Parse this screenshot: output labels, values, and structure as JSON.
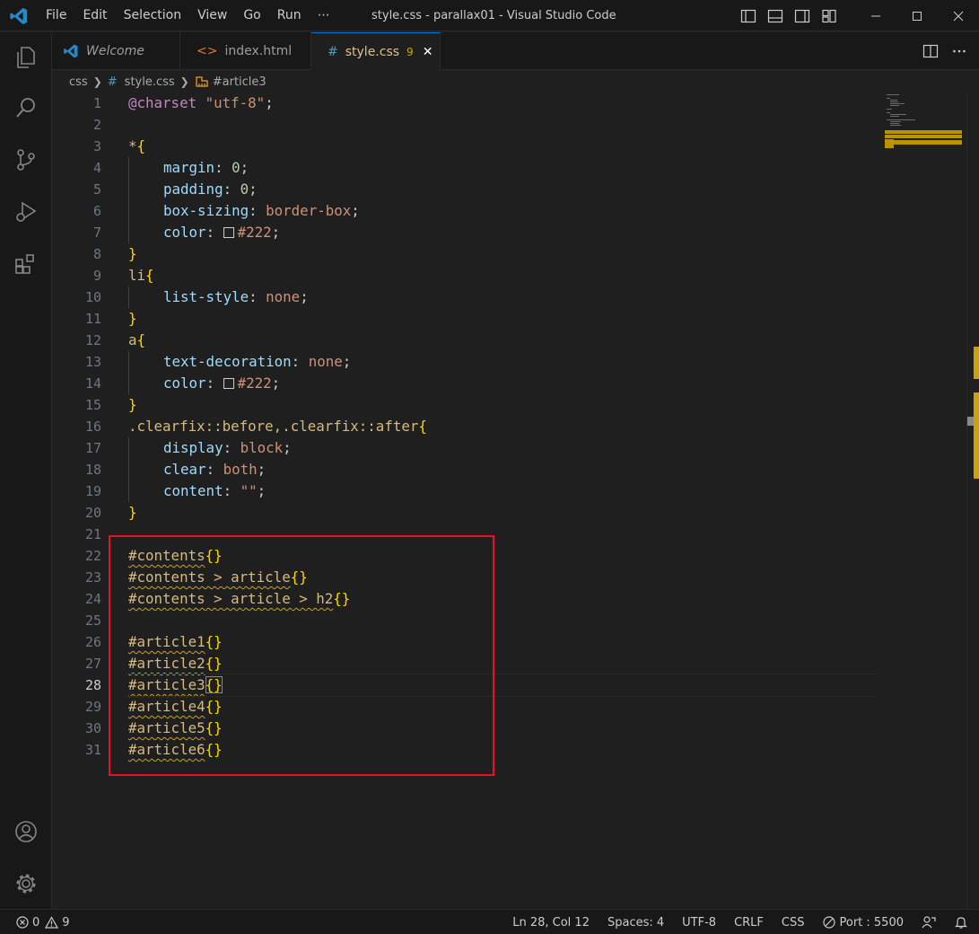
{
  "titlebar": {
    "menu": [
      "File",
      "Edit",
      "Selection",
      "View",
      "Go",
      "Run",
      "⋯"
    ],
    "title": "style.css - parallax01 - Visual Studio Code"
  },
  "tabs": [
    {
      "label": "Welcome",
      "icon": "vscode-logo-icon"
    },
    {
      "label": "index.html",
      "icon": "html-file-icon"
    },
    {
      "label": "style.css",
      "icon": "css-file-icon",
      "problems": "9",
      "close": "✕"
    }
  ],
  "breadcrumb": {
    "folder": "css",
    "file": "style.css",
    "symbol": "#article3"
  },
  "editor": {
    "current_line": "28",
    "line_numbers": [
      "1",
      "2",
      "3",
      "4",
      "5",
      "6",
      "7",
      "8",
      "9",
      "10",
      "11",
      "12",
      "13",
      "14",
      "15",
      "16",
      "17",
      "18",
      "19",
      "20",
      "21",
      "22",
      "23",
      "24",
      "25",
      "26",
      "27",
      "28",
      "29",
      "30",
      "31"
    ],
    "lines": {
      "l1": {
        "at": "@charset",
        "str": "\"utf-8\"",
        "end": ";"
      },
      "l3": {
        "sel": "*",
        "b": "{"
      },
      "l4": {
        "p": "margin",
        "c": ": ",
        "v": "0",
        "e": ";"
      },
      "l5": {
        "p": "padding",
        "c": ": ",
        "v": "0",
        "e": ";"
      },
      "l6": {
        "p": "box-sizing",
        "c": ": ",
        "v": "border-box",
        "e": ";"
      },
      "l7": {
        "p": "color",
        "c": ": ",
        "v": "#222",
        "e": ";"
      },
      "l8": {
        "b": "}"
      },
      "l9": {
        "sel": "li",
        "b": "{"
      },
      "l10": {
        "p": "list-style",
        "c": ": ",
        "v": "none",
        "e": ";"
      },
      "l11": {
        "b": "}"
      },
      "l12": {
        "sel": "a",
        "b": "{"
      },
      "l13": {
        "p": "text-decoration",
        "c": ": ",
        "v": "none",
        "e": ";"
      },
      "l14": {
        "p": "color",
        "c": ": ",
        "v": "#222",
        "e": ";"
      },
      "l15": {
        "b": "}"
      },
      "l16": {
        "sel": ".clearfix::before,.clearfix::after",
        "b": "{"
      },
      "l17": {
        "p": "display",
        "c": ": ",
        "v": "block",
        "e": ";"
      },
      "l18": {
        "p": "clear",
        "c": ": ",
        "v": "both",
        "e": ";"
      },
      "l19": {
        "p": "content",
        "c": ": ",
        "v": "\"\"",
        "e": ";"
      },
      "l20": {
        "b": "}"
      },
      "l22": {
        "sel": "#contents",
        "b": "{}"
      },
      "l23": {
        "sel": "#contents > article",
        "b": "{}"
      },
      "l24": {
        "sel": "#contents > article > h2",
        "b": "{}"
      },
      "l26": {
        "sel": "#article1",
        "b": "{}"
      },
      "l27": {
        "sel": "#article2",
        "b": "{}"
      },
      "l28": {
        "sel": "#article3",
        "b": "{}"
      },
      "l29": {
        "sel": "#article4",
        "b": "{}"
      },
      "l30": {
        "sel": "#article5",
        "b": "{}"
      },
      "l31": {
        "sel": "#article6",
        "b": "{}"
      }
    }
  },
  "statusbar": {
    "errors": "0",
    "warnings": "9",
    "position": "Ln 28, Col 12",
    "spaces": "Spaces: 4",
    "encoding": "UTF-8",
    "eol": "CRLF",
    "language": "CSS",
    "port": "Port : 5500"
  },
  "colors": {
    "accent": "#0078d4",
    "highlight_box": "#e81123",
    "warning": "#cca700",
    "modified_tab": "#e2c08d"
  }
}
